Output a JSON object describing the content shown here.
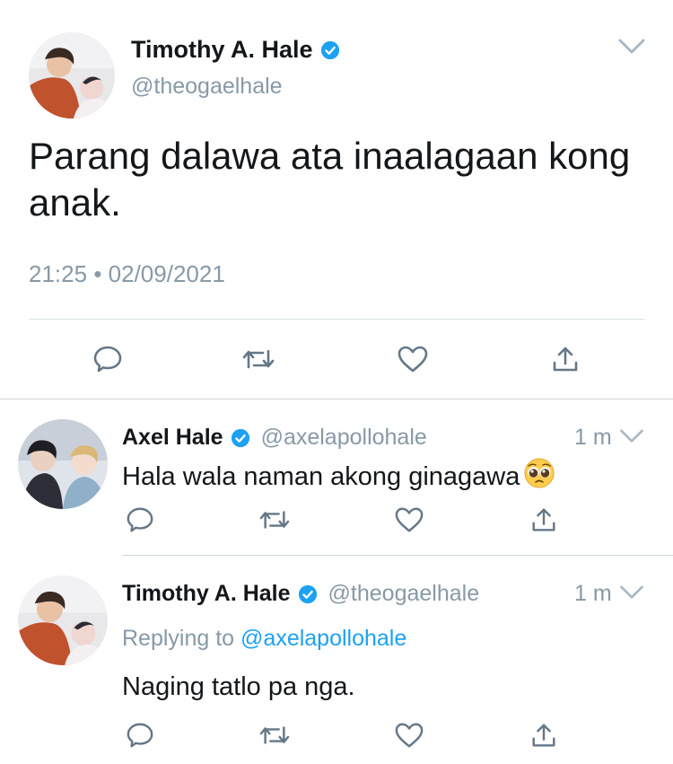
{
  "colors": {
    "accent": "#1da1f2",
    "secondary_text": "#8899a6",
    "primary_text": "#14171a",
    "divider": "#cfd6da"
  },
  "main_tweet": {
    "author_name": "Timothy A. Hale",
    "verified": true,
    "handle": "@theogaelhale",
    "text": "Parang dalawa ata inaalagaan kong anak.",
    "time": "21:25",
    "separator": "•",
    "date": "02/09/2021",
    "menu_icon": "chevron-down-icon",
    "actions": [
      "reply-icon",
      "retweet-icon",
      "like-icon",
      "share-icon"
    ]
  },
  "replies": [
    {
      "author_name": "Axel Hale",
      "verified": true,
      "handle": "@axelapollohale",
      "time": "1 m",
      "text": "Hala wala naman akong ginagawa",
      "emoji": "pleading-face-emoji",
      "actions": [
        "reply-icon",
        "retweet-icon",
        "like-icon",
        "share-icon"
      ]
    },
    {
      "author_name": "Timothy A. Hale",
      "verified": true,
      "handle": "@theogaelhale",
      "time": "1 m",
      "replying_prefix": "Replying to",
      "replying_to": "@axelapollohale",
      "text": "Naging tatlo pa nga.",
      "actions": [
        "reply-icon",
        "retweet-icon",
        "like-icon",
        "share-icon"
      ]
    }
  ]
}
